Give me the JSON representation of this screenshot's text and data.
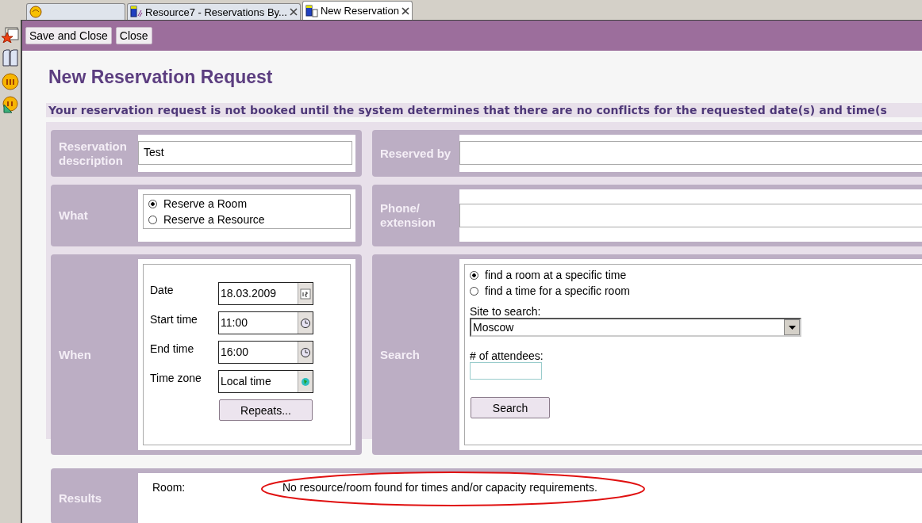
{
  "tabs": [
    {
      "kind": "home",
      "selected": false
    },
    {
      "kind": "view",
      "label": "Resource7 - Reservations By...",
      "selected": false
    },
    {
      "kind": "form",
      "label": "New Reservation",
      "selected": true
    }
  ],
  "toolbar": {
    "buttons": [
      "Save and Close",
      "Close"
    ]
  },
  "title": "New Reservation Request",
  "notice": "Your reservation request is not booked until the system determines that there are no conflicts for the requested date(s) and time(s",
  "description": {
    "label": "Reservation description",
    "value": "Test"
  },
  "reserved_by": {
    "label": "Reserved by"
  },
  "what": {
    "label": "What",
    "options": [
      {
        "label": "Reserve a Room",
        "selected": true
      },
      {
        "label": "Reserve a Resource",
        "selected": false
      }
    ]
  },
  "phone": {
    "label": "Phone/ extension"
  },
  "when": {
    "label": "When",
    "fields": [
      {
        "label": "Date",
        "value": "18.03.2009",
        "kind": "date"
      },
      {
        "label": "Start time",
        "value": "11:00",
        "kind": "time"
      },
      {
        "label": "End time",
        "value": "16:00",
        "kind": "time"
      },
      {
        "label": "Time zone",
        "value": "Local time",
        "kind": "zone"
      }
    ],
    "repeats_button": "Repeats..."
  },
  "search": {
    "label": "Search",
    "options": [
      {
        "label": "find a room at a specific time",
        "selected": true
      },
      {
        "label": "find a time for a specific room",
        "selected": false
      }
    ],
    "site_label": "Site to search:",
    "site_value": "Moscow",
    "attendees_label": "# of attendees:",
    "button": "Search"
  },
  "results": {
    "label": "Results",
    "room_label": "Room:",
    "message": "No resource/room found for times and/or capacity requirements.",
    "highlighted": true
  }
}
